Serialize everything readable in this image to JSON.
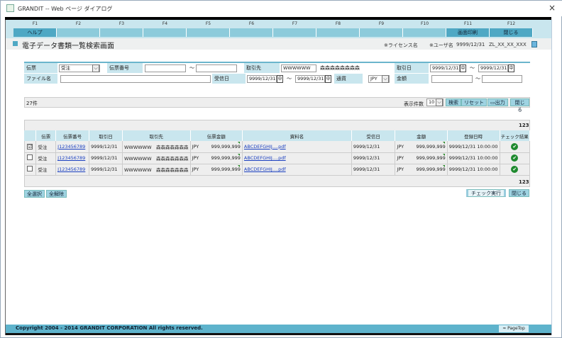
{
  "window": {
    "title": "GRANDIT -- Web ページ ダイアログ",
    "close": "×"
  },
  "fkeys": [
    {
      "key": "F1",
      "label": "ヘルプ"
    },
    {
      "key": "F2",
      "label": ""
    },
    {
      "key": "F3",
      "label": ""
    },
    {
      "key": "F4",
      "label": ""
    },
    {
      "key": "F5",
      "label": ""
    },
    {
      "key": "F6",
      "label": ""
    },
    {
      "key": "F7",
      "label": ""
    },
    {
      "key": "F8",
      "label": ""
    },
    {
      "key": "F9",
      "label": ""
    },
    {
      "key": "F10",
      "label": ""
    },
    {
      "key": "F11",
      "label": "画面印刷"
    },
    {
      "key": "F12",
      "label": "閉じる"
    }
  ],
  "header": {
    "title": "電子データ書類一覧検索画面",
    "license": "※ライセンス名",
    "user_label": "※ユーザ名",
    "date": "9999/12/31",
    "user": "ZL_XX_XX_XXX"
  },
  "form": {
    "denpyo_label": "伝票",
    "denpyo_value": "受注",
    "denpyo_no_label": "伝票番号",
    "tilde": "～",
    "torihikisaki_label": "取引先",
    "torihikisaki_code": "WWWWWW",
    "torihikisaki_name": "森森森森森森森森",
    "torihikibi_label": "取引日",
    "torihikibi_from": "9999/12/31",
    "torihikibi_to": "9999/12/31",
    "file_label": "ファイル名",
    "jushinbi_label": "受信日",
    "jushinbi_from": "9999/12/31",
    "jushinbi_to": "9999/12/31",
    "tsuka_label": "通貨",
    "tsuka_value": "JPY",
    "kingaku_label": "金額",
    "cal_icon": "中"
  },
  "results": {
    "count": "27件",
    "per_page_label": "表示件数",
    "per_page": "10",
    "search": "検索",
    "reset": "リセット",
    "output": "出力",
    "close": "閉じる"
  },
  "table": {
    "pager": [
      "1",
      "2",
      "3"
    ],
    "headers": [
      "",
      "伝票",
      "伝票番号",
      "取引日",
      "取引先",
      "伝票金額",
      "資料名",
      "受信日",
      "金額",
      "登録日時",
      "チェック結果"
    ],
    "rows": [
      {
        "checked": "☑",
        "denpyo": "受注",
        "no": "J123456789",
        "date": "9999/12/31",
        "partner": "WWWWWW　森森森森森森森",
        "cur": "JPY",
        "amount": "999,999,999",
        "file": "ABCDEFGHIJ....pdf",
        "recv": "9999/12/31",
        "cur2": "JPY",
        "amount2": "999,999,999",
        "reg": "9999/12/31 10:00:00",
        "check": "✔"
      },
      {
        "checked": "",
        "denpyo": "受注",
        "no": "J123456789",
        "date": "9999/12/31",
        "partner": "WWWWWW　森森森森森森森",
        "cur": "JPY",
        "amount": "999,999,999",
        "file": "ABCDEFGHIJ....pdf",
        "recv": "9999/12/31",
        "cur2": "JPY",
        "amount2": "999,999,999",
        "reg": "9999/12/31 10:00:00",
        "check": "✔"
      },
      {
        "checked": "",
        "denpyo": "受注",
        "no": "J123456789",
        "date": "9999/12/31",
        "partner": "WWWWWW　森森森森森森森",
        "cur": "JPY",
        "amount": "999,999,999",
        "file": "ABCDEFGHIJ....pdf",
        "recv": "9999/12/31",
        "cur2": "JPY",
        "amount2": "999,999,999",
        "reg": "9999/12/31 10:00:00",
        "check": "✔"
      }
    ]
  },
  "actions": {
    "select_all": "全選択",
    "deselect_all": "全解除",
    "check_run": "チェック実行",
    "close": "閉じる"
  },
  "footer": {
    "copyright": "Copyright 2004 - 2014 GRANDIT CORPORATION All rights reserved.",
    "pagetop": "≈ PageTop"
  }
}
